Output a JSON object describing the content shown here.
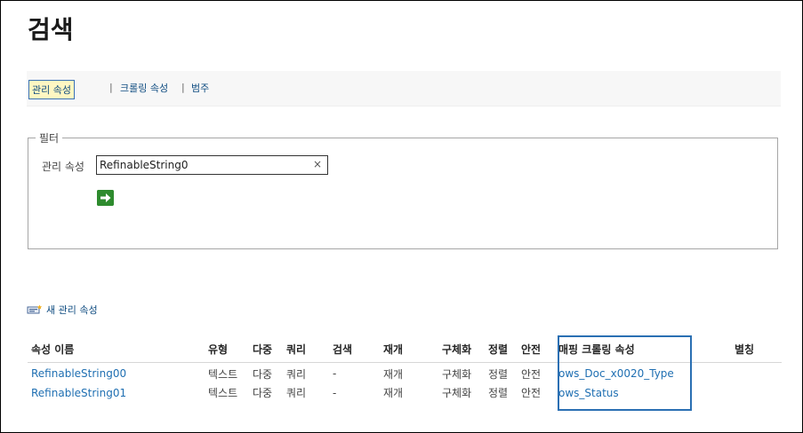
{
  "page": {
    "title": "검색"
  },
  "subnav": {
    "items": [
      {
        "label": "관리 속성",
        "selected": true
      },
      {
        "label": "크롤링 속성",
        "selected": false
      },
      {
        "label": "범주",
        "selected": false
      }
    ],
    "separator": "|"
  },
  "filter": {
    "legend": "필터",
    "field_label": "관리 속성",
    "value": "RefinableString0",
    "clear_glyph": "×",
    "go_icon": "green-arrow-right-icon"
  },
  "new_property": {
    "label": "새 관리 속성",
    "icon": "new-item-icon"
  },
  "table": {
    "headers": [
      "속성 이름",
      "유형",
      "다중",
      "쿼리",
      "검색",
      "재개",
      "구체화",
      "정렬",
      "안전",
      "매핑 크롤링 속성",
      "별칭"
    ],
    "rows": [
      {
        "name": "RefinableString00",
        "type": "텍스트",
        "multi": "다중",
        "query": "쿼리",
        "search": "-",
        "retrieve": "재개",
        "refine": "구체화",
        "sort": "정렬",
        "safe": "안전",
        "mapped": "ows_Doc_x0020_Type",
        "alias": ""
      },
      {
        "name": "RefinableString01",
        "type": "텍스트",
        "multi": "다중",
        "query": "쿼리",
        "search": "-",
        "retrieve": "재개",
        "refine": "구체화",
        "sort": "정렬",
        "safe": "안전",
        "mapped": "ows_Status",
        "alias": ""
      }
    ]
  },
  "colors": {
    "link": "#1f6fb2",
    "highlight_border": "#2a6fb3",
    "selected_bg": "#fff7c2"
  }
}
